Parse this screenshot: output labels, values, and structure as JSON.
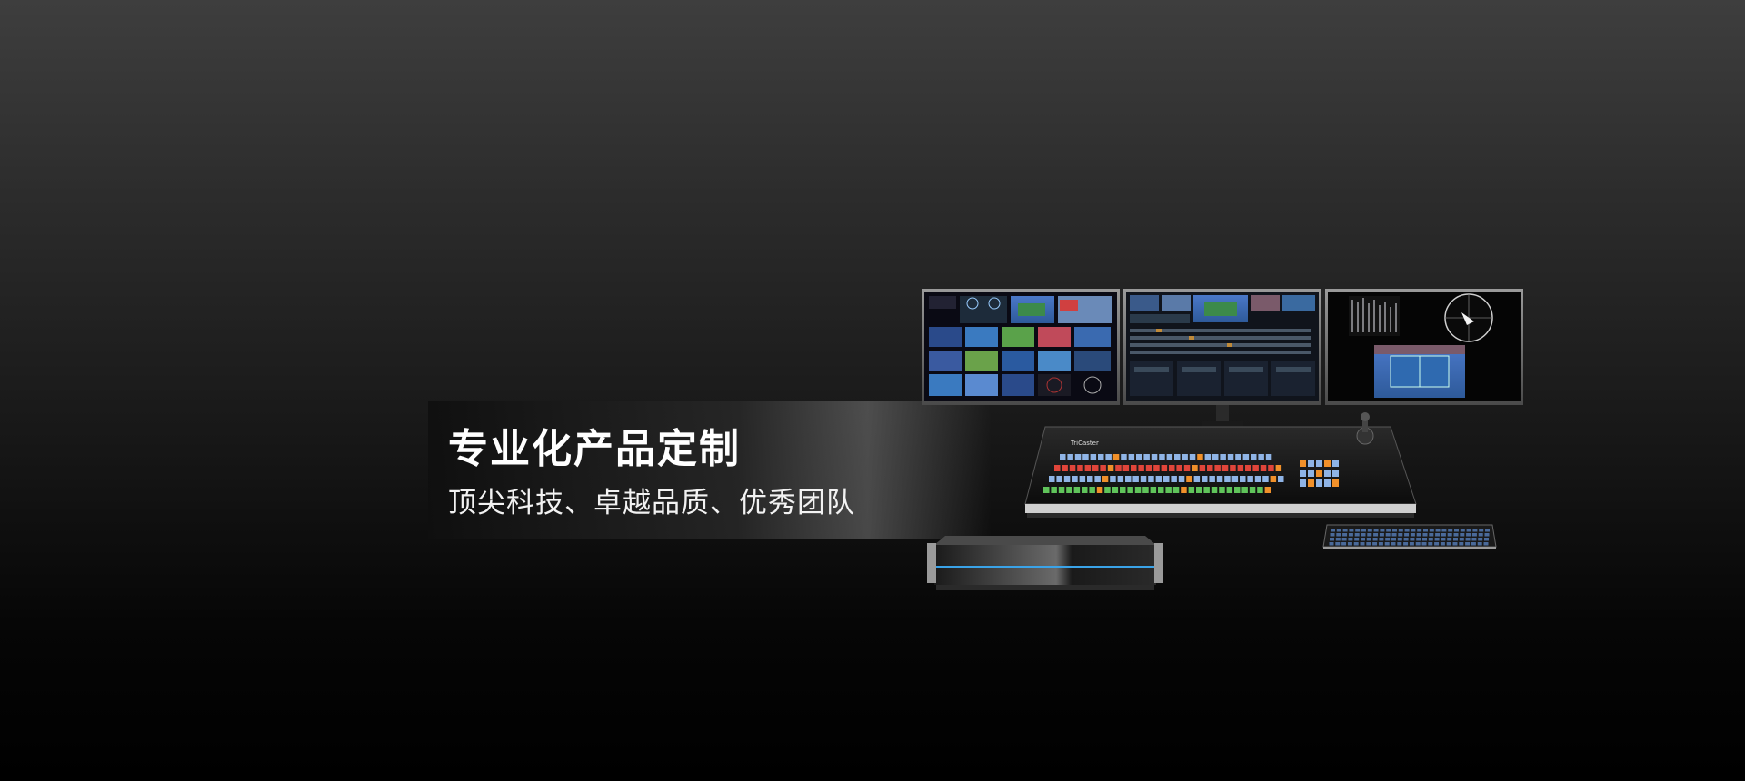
{
  "banner": {
    "title": "专业化产品定制",
    "subtitle": "顶尖科技、卓越品质、优秀团队",
    "product_brand": "TriCaster"
  },
  "colors": {
    "accent_blue": "#3aa3e8",
    "button_orange": "#f0902a",
    "button_green": "#5fc35a",
    "button_red": "#e0453a",
    "button_blue": "#8fb4e6"
  }
}
